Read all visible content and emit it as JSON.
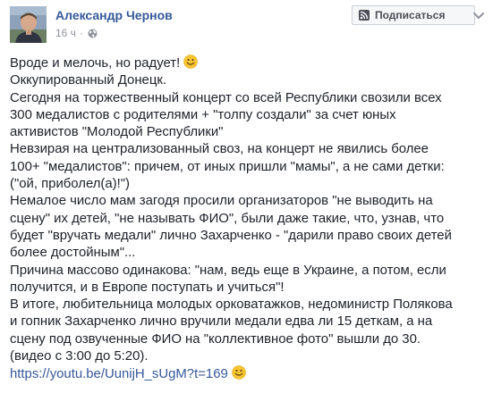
{
  "author": {
    "name": "Александр Чернов"
  },
  "meta": {
    "timestamp": "16 ч",
    "separator": "·",
    "privacy_icon": "globe-icon"
  },
  "subscribe": {
    "label": "Подписаться",
    "icon": "rss-icon"
  },
  "menu": {
    "icon": "chevron-down-icon"
  },
  "post": {
    "lines": [
      "Вроде и мелочь, но радует!",
      "Оккупированный Донецк.",
      "Сегодня на торжественный концерт со всей Республики свозили всех",
      "300 медалистов с родителями + \"толпу создали\" за счет юных",
      "активистов \"Молодой Республики\"",
      "Невзирая на централизованный своз, на концерт не явились более",
      "100+ \"медалистов\": причем, от иных пришли \"мамы\", а не сами детки:",
      "(\"ой, приболел(а)!\")",
      "Немалое число мам загодя просили организаторов \"не выводить на",
      "сцену\" их детей, \"не называть ФИО\", были даже такие, что, узнав, что",
      "будет \"вручать медали\" лично Захарченко - \"дарили право своих детей",
      "более достойным\"...",
      "Причина массово одинакова: \"нам, ведь еще в Украине, а потом, если",
      "получится, и в Европе поступать и учиться\"!",
      "В итоге, любительница молодых орковатажков, недоминистр Полякова",
      "и гопник Захарченко лично вручили медали едва ли 15 деткам, а на",
      "сцену под озвученные ФИО на \"коллективное фото\" вышли до 30.",
      "(видео с 3:00 до 5:20)."
    ],
    "link": "https://youtu.be/UunijH_sUgM?t=169",
    "emoji": "smile-emoji-icon"
  },
  "colors": {
    "author": "#365899",
    "link": "#365899",
    "text": "#1d2129",
    "meta": "#90949c",
    "emoji": "#f7c531"
  }
}
